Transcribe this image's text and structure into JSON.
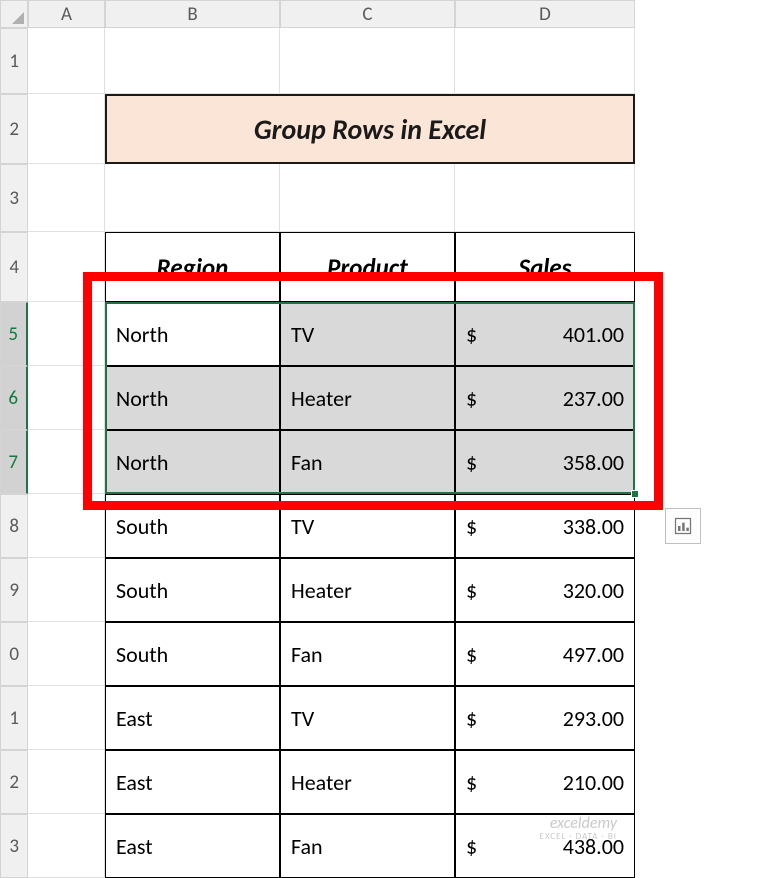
{
  "columns": [
    "A",
    "B",
    "C",
    "D"
  ],
  "visibleRows": [
    "1",
    "2",
    "3",
    "4",
    "5",
    "6",
    "7",
    "8",
    "9",
    "0",
    "1",
    "2",
    "3"
  ],
  "title": "Group Rows in Excel",
  "headers": {
    "region": "Region",
    "product": "Product",
    "sales": "Sales"
  },
  "currency": "$",
  "rows": [
    {
      "region": "North",
      "product": "TV",
      "sales": "401.00"
    },
    {
      "region": "North",
      "product": "Heater",
      "sales": "237.00"
    },
    {
      "region": "North",
      "product": "Fan",
      "sales": "358.00"
    },
    {
      "region": "South",
      "product": "TV",
      "sales": "338.00"
    },
    {
      "region": "South",
      "product": "Heater",
      "sales": "320.00"
    },
    {
      "region": "South",
      "product": "Fan",
      "sales": "497.00"
    },
    {
      "region": "East",
      "product": "TV",
      "sales": "293.00"
    },
    {
      "region": "East",
      "product": "Heater",
      "sales": "210.00"
    },
    {
      "region": "East",
      "product": "Fan",
      "sales": "438.00"
    }
  ],
  "watermark": {
    "line1": "exceldemy",
    "line2": "EXCEL · DATA · BI"
  },
  "quickAnalysisTooltip": "Quick Analysis"
}
